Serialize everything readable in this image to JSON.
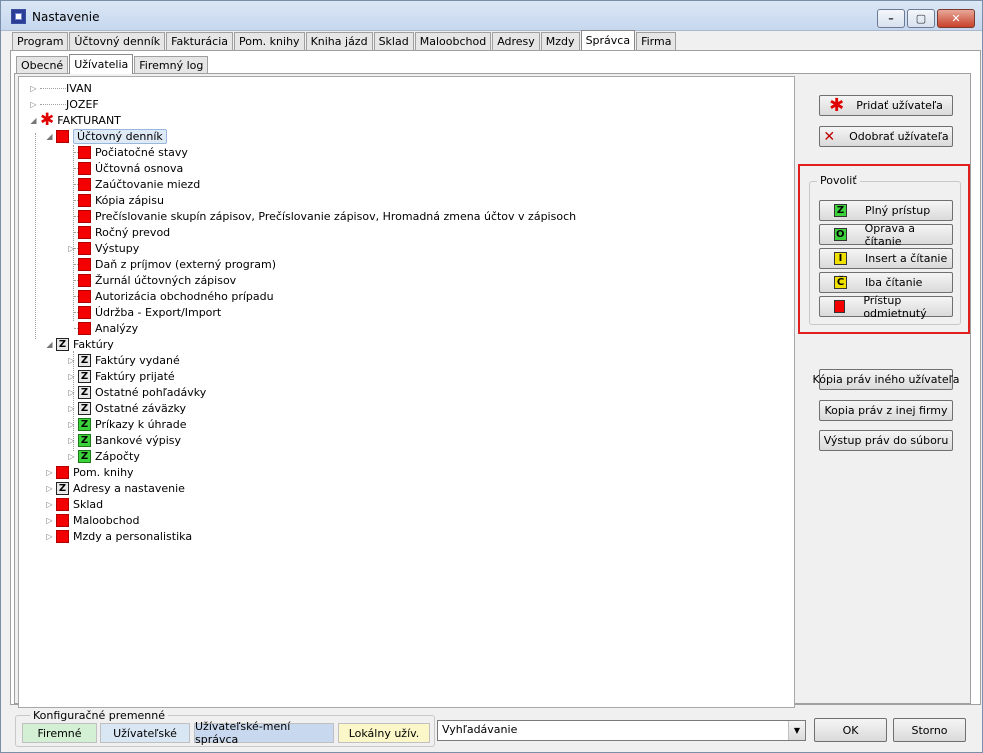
{
  "window": {
    "title": "Nastavenie"
  },
  "main_tabs": [
    "Program",
    "Účtovný denník",
    "Fakturácia",
    "Pom. knihy",
    "Kniha jázd",
    "Sklad",
    "Maloobchod",
    "Adresy",
    "Mzdy",
    "Správca",
    "Firma"
  ],
  "main_tab_active": "Správca",
  "sub_tabs": [
    "Obecné",
    "Užívatelia",
    "Firemný log"
  ],
  "sub_tab_active": "Užívatelia",
  "tree": {
    "users": [
      "IVAN",
      "JOZEF",
      "FAKTURANT"
    ],
    "selected": "Účtovný denník",
    "uctovny_dennik_children": [
      "Počiatočné stavy",
      "Účtovná osnova",
      "Zaúčtovanie miezd",
      "Kópia zápisu",
      "Prečíslovanie skupín zápisov, Prečíslovanie zápisov, Hromadná zmena účtov v zápisoch",
      "Ročný prevod",
      "Výstupy",
      "Daň z príjmov (externý program)",
      "Žurnál účtovných zápisov",
      "Autorizácia obchodného prípadu",
      "Údržba - Export/Import",
      "Analýzy"
    ],
    "faktury": "Faktúry",
    "faktury_children": [
      {
        "label": "Faktúry vydané",
        "icon": "Z",
        "color": "gray"
      },
      {
        "label": "Faktúry prijaté",
        "icon": "Z",
        "color": "gray"
      },
      {
        "label": "Ostatné pohľadávky",
        "icon": "Z",
        "color": "gray"
      },
      {
        "label": "Ostatné záväzky",
        "icon": "Z",
        "color": "gray"
      },
      {
        "label": "Príkazy k úhrade",
        "icon": "Z",
        "color": "green"
      },
      {
        "label": "Bankové výpisy",
        "icon": "Z",
        "color": "green"
      },
      {
        "label": "Zápočty",
        "icon": "Z",
        "color": "green"
      }
    ],
    "modules": [
      {
        "label": "Pom. knihy",
        "icon": "",
        "color": "red"
      },
      {
        "label": "Adresy a nastavenie",
        "icon": "Z",
        "color": "gray"
      },
      {
        "label": "Sklad",
        "icon": "",
        "color": "red"
      },
      {
        "label": "Maloobchod",
        "icon": "",
        "color": "red"
      },
      {
        "label": "Mzdy a personalistika",
        "icon": "",
        "color": "red"
      }
    ]
  },
  "buttons": {
    "add_user": "Pridať užívateľa",
    "remove_user": "Odobrať užívateľa",
    "copy_rights_user": "Kópia práv iného užívateľa",
    "copy_rights_firm": "Kopia práv z inej firmy",
    "export_rights": "Výstup práv do súboru",
    "ok": "OK",
    "cancel": "Storno"
  },
  "permissions": {
    "title": "Povoliť",
    "items": [
      {
        "label": "Plný prístup",
        "icon": "Z",
        "color": "#3cd23c"
      },
      {
        "label": "Oprava a čítanie",
        "icon": "O",
        "color": "#3cd23c"
      },
      {
        "label": "Insert a čítanie",
        "icon": "I",
        "color": "#f0e000"
      },
      {
        "label": "Iba čítanie",
        "icon": "Č",
        "color": "#f0e000"
      },
      {
        "label": "Prístup odmietnutý",
        "icon": "",
        "color": "#f50000"
      }
    ]
  },
  "config": {
    "title": "Konfiguračné premenné",
    "items": [
      {
        "label": "Firemné",
        "bg": "#d4f0d4"
      },
      {
        "label": "Užívateľské",
        "bg": "#d9e6f4"
      },
      {
        "label": "Užívateľské-mení správca",
        "bg": "#c8d8ee"
      },
      {
        "label": "Lokálny užív.",
        "bg": "#fbf7c8"
      }
    ]
  },
  "search": {
    "value": "Vyhľadávanie"
  }
}
